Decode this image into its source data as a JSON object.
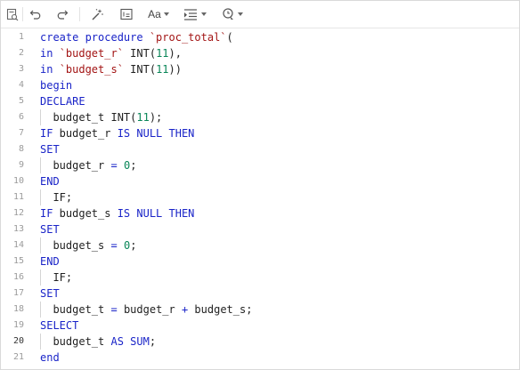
{
  "toolbar": {
    "format_label": "Aa",
    "items": [
      {
        "name": "find-replace-icon"
      },
      {
        "name": "undo-icon"
      },
      {
        "name": "redo-icon"
      },
      {
        "name": "beautify-wand-icon"
      },
      {
        "name": "line-numbers-icon"
      },
      {
        "name": "font-format-icon"
      },
      {
        "name": "indent-icon"
      },
      {
        "name": "snippets-icon"
      }
    ]
  },
  "editor": {
    "active_line": 20,
    "lines": [
      {
        "n": "1",
        "tokens": [
          {
            "t": "create procedure ",
            "c": "kw"
          },
          {
            "t": "`proc_total`",
            "c": "str"
          },
          {
            "t": "(",
            "c": "plain"
          }
        ]
      },
      {
        "n": "2",
        "tokens": [
          {
            "t": "in ",
            "c": "kw"
          },
          {
            "t": "`budget_r`",
            "c": "str"
          },
          {
            "t": " INT(",
            "c": "plain"
          },
          {
            "t": "11",
            "c": "num"
          },
          {
            "t": "),",
            "c": "plain"
          }
        ]
      },
      {
        "n": "3",
        "tokens": [
          {
            "t": "in ",
            "c": "kw"
          },
          {
            "t": "`budget_s`",
            "c": "str"
          },
          {
            "t": " INT(",
            "c": "plain"
          },
          {
            "t": "11",
            "c": "num"
          },
          {
            "t": "))",
            "c": "plain"
          }
        ]
      },
      {
        "n": "4",
        "tokens": [
          {
            "t": "begin",
            "c": "kw"
          }
        ]
      },
      {
        "n": "5",
        "tokens": [
          {
            "t": "DECLARE",
            "c": "kw"
          }
        ]
      },
      {
        "n": "6",
        "indent": true,
        "tokens": [
          {
            "t": "  budget_t INT(",
            "c": "plain"
          },
          {
            "t": "11",
            "c": "num"
          },
          {
            "t": ");",
            "c": "plain"
          }
        ]
      },
      {
        "n": "7",
        "tokens": [
          {
            "t": "IF",
            "c": "kw"
          },
          {
            "t": " budget_r ",
            "c": "plain"
          },
          {
            "t": "IS NULL THEN",
            "c": "kw"
          }
        ]
      },
      {
        "n": "8",
        "tokens": [
          {
            "t": "SET",
            "c": "kw"
          }
        ]
      },
      {
        "n": "9",
        "indent": true,
        "tokens": [
          {
            "t": "  budget_r ",
            "c": "plain"
          },
          {
            "t": "=",
            "c": "kw"
          },
          {
            "t": " ",
            "c": "plain"
          },
          {
            "t": "0",
            "c": "num"
          },
          {
            "t": ";",
            "c": "plain"
          }
        ]
      },
      {
        "n": "10",
        "tokens": [
          {
            "t": "END",
            "c": "kw"
          }
        ]
      },
      {
        "n": "11",
        "indent": true,
        "tokens": [
          {
            "t": "  IF;",
            "c": "plain"
          }
        ]
      },
      {
        "n": "12",
        "tokens": [
          {
            "t": "IF",
            "c": "kw"
          },
          {
            "t": " budget_s ",
            "c": "plain"
          },
          {
            "t": "IS NULL THEN",
            "c": "kw"
          }
        ]
      },
      {
        "n": "13",
        "tokens": [
          {
            "t": "SET",
            "c": "kw"
          }
        ]
      },
      {
        "n": "14",
        "indent": true,
        "tokens": [
          {
            "t": "  budget_s ",
            "c": "plain"
          },
          {
            "t": "=",
            "c": "kw"
          },
          {
            "t": " ",
            "c": "plain"
          },
          {
            "t": "0",
            "c": "num"
          },
          {
            "t": ";",
            "c": "plain"
          }
        ]
      },
      {
        "n": "15",
        "tokens": [
          {
            "t": "END",
            "c": "kw"
          }
        ]
      },
      {
        "n": "16",
        "indent": true,
        "tokens": [
          {
            "t": "  IF;",
            "c": "plain"
          }
        ]
      },
      {
        "n": "17",
        "tokens": [
          {
            "t": "SET",
            "c": "kw"
          }
        ]
      },
      {
        "n": "18",
        "indent": true,
        "tokens": [
          {
            "t": "  budget_t ",
            "c": "plain"
          },
          {
            "t": "=",
            "c": "kw"
          },
          {
            "t": " budget_r ",
            "c": "plain"
          },
          {
            "t": "+",
            "c": "kw"
          },
          {
            "t": " budget_s;",
            "c": "plain"
          }
        ]
      },
      {
        "n": "19",
        "tokens": [
          {
            "t": "SELECT",
            "c": "kw"
          }
        ]
      },
      {
        "n": "20",
        "indent": true,
        "tokens": [
          {
            "t": "  budget_t ",
            "c": "plain"
          },
          {
            "t": "AS SUM",
            "c": "kw"
          },
          {
            "t": ";",
            "c": "plain"
          }
        ]
      },
      {
        "n": "21",
        "tokens": [
          {
            "t": "end",
            "c": "kw"
          }
        ]
      }
    ]
  }
}
